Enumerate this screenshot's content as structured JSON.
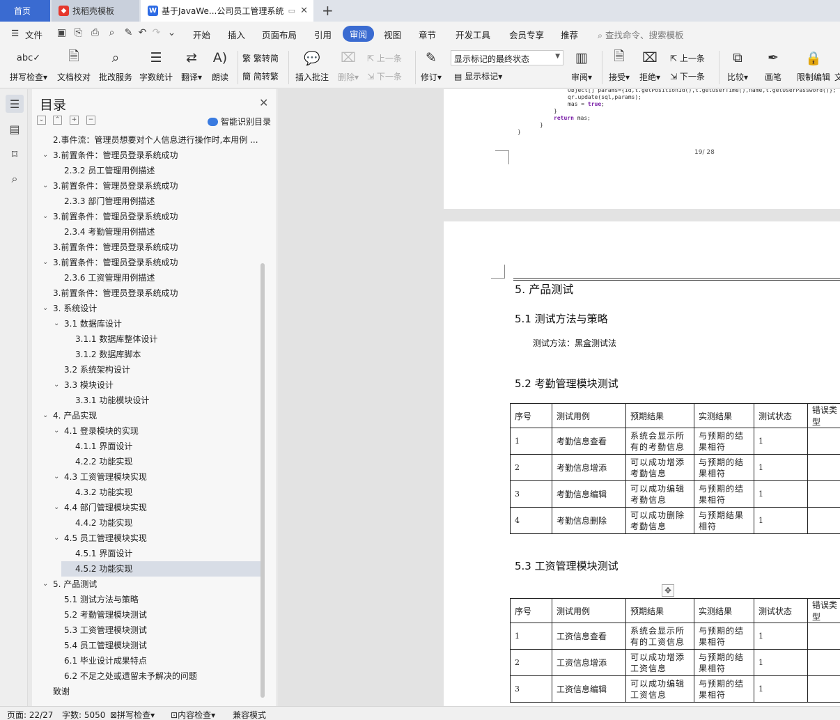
{
  "tabs": {
    "home": "首页",
    "template": "找稻壳模板",
    "document": "基于JavaWe...公司员工管理系统"
  },
  "menu": {
    "file": "文件",
    "items": [
      "开始",
      "插入",
      "页面布局",
      "引用",
      "审阅",
      "视图",
      "章节",
      "开发工具",
      "会员专享",
      "推荐"
    ],
    "search_placeholder": "查找命令、搜索模板"
  },
  "ribbon": {
    "spell_check": "拼写检查",
    "doc_proof": "文档校对",
    "revise_service": "批改服务",
    "word_count": "字数统计",
    "translate": "翻译",
    "read_aloud": "朗读",
    "trad_to_simp": "繁转简",
    "simp_to_trad": "简转繁",
    "insert_comment": "插入批注",
    "delete": "删除",
    "prev_comment": "上一条",
    "next_comment": "下一条",
    "track_changes": "修订",
    "markup_state": "显示标记的最终状态",
    "show_markup": "显示标记",
    "review": "审阅",
    "accept": "接受",
    "reject": "拒绝",
    "prev_change": "上一条",
    "next_change": "下一条",
    "compare": "比较",
    "pen": "画笔",
    "restrict_edit": "限制编辑",
    "cut_off": "文"
  },
  "nav": {
    "title": "目录",
    "smart_toc": "智能识别目录",
    "items": [
      {
        "text": "2.事件流：管理员想要对个人信息进行操作时,本用例 ...",
        "level": 1,
        "chev": false,
        "sel": false
      },
      {
        "text": "3.前置条件：管理员登录系统成功",
        "level": 1,
        "chev": true,
        "sel": false
      },
      {
        "text": "2.3.2 员工管理用例描述",
        "level": 2,
        "chev": false,
        "sel": false
      },
      {
        "text": "3.前置条件：管理员登录系统成功",
        "level": 1,
        "chev": true,
        "sel": false
      },
      {
        "text": "2.3.3 部门管理用例描述",
        "level": 2,
        "chev": false,
        "sel": false
      },
      {
        "text": "3.前置条件：管理员登录系统成功",
        "level": 1,
        "chev": true,
        "sel": false
      },
      {
        "text": "2.3.4 考勤管理用例描述",
        "level": 2,
        "chev": false,
        "sel": false
      },
      {
        "text": "3.前置条件：管理员登录系统成功",
        "level": 1,
        "chev": false,
        "sel": false
      },
      {
        "text": "3.前置条件：管理员登录系统成功",
        "level": 1,
        "chev": true,
        "sel": false
      },
      {
        "text": "2.3.6 工资管理用例描述",
        "level": 2,
        "chev": false,
        "sel": false
      },
      {
        "text": "3.前置条件：管理员登录系统成功",
        "level": 1,
        "chev": false,
        "sel": false
      },
      {
        "text": "3. 系统设计",
        "level": 1,
        "chev": true,
        "sel": false
      },
      {
        "text": "3.1 数据库设计",
        "level": 2,
        "chev": true,
        "sel": false
      },
      {
        "text": "3.1.1 数据库整体设计",
        "level": 3,
        "chev": false,
        "sel": false
      },
      {
        "text": "3.1.2 数据库脚本",
        "level": 3,
        "chev": false,
        "sel": false
      },
      {
        "text": "3.2 系统架构设计",
        "level": 2,
        "chev": false,
        "sel": false
      },
      {
        "text": "3.3 模块设计",
        "level": 2,
        "chev": true,
        "sel": false
      },
      {
        "text": "3.3.1 功能模块设计",
        "level": 3,
        "chev": false,
        "sel": false
      },
      {
        "text": "4. 产品实现",
        "level": 1,
        "chev": true,
        "sel": false
      },
      {
        "text": "4.1 登录模块的实现",
        "level": 2,
        "chev": true,
        "sel": false
      },
      {
        "text": "4.1.1 界面设计",
        "level": 3,
        "chev": false,
        "sel": false
      },
      {
        "text": "4.2.2 功能实现",
        "level": 3,
        "chev": false,
        "sel": false
      },
      {
        "text": "4.3 工资管理模块实现",
        "level": 2,
        "chev": true,
        "sel": false
      },
      {
        "text": "4.3.2 功能实现",
        "level": 3,
        "chev": false,
        "sel": false
      },
      {
        "text": "4.4 部门管理模块实现",
        "level": 2,
        "chev": true,
        "sel": false
      },
      {
        "text": "4.4.2 功能实现",
        "level": 3,
        "chev": false,
        "sel": false
      },
      {
        "text": "4.5 员工管理模块实现",
        "level": 2,
        "chev": true,
        "sel": false
      },
      {
        "text": "4.5.1 界面设计",
        "level": 3,
        "chev": false,
        "sel": false
      },
      {
        "text": "4.5.2 功能实现",
        "level": 3,
        "chev": false,
        "sel": true
      },
      {
        "text": "5. 产品测试",
        "level": 1,
        "chev": true,
        "sel": false
      },
      {
        "text": "5.1 测试方法与策略",
        "level": 2,
        "chev": false,
        "sel": false
      },
      {
        "text": "5.2 考勤管理模块测试",
        "level": 2,
        "chev": false,
        "sel": false
      },
      {
        "text": "5.3 工资管理模块测试",
        "level": 2,
        "chev": false,
        "sel": false
      },
      {
        "text": "5.4 员工管理模块测试",
        "level": 2,
        "chev": false,
        "sel": false
      },
      {
        "text": "6.1 毕业设计成果特点",
        "level": 2,
        "chev": false,
        "sel": false
      },
      {
        "text": "6.2 不足之处或遗留未予解决的问题",
        "level": 2,
        "chev": false,
        "sel": false
      },
      {
        "text": "致谢",
        "level": 1,
        "chev": false,
        "sel": false
      }
    ]
  },
  "doc": {
    "code_lines": [
      "Object[] params={id,t.getPositionId(),t.getUserTime(),name,t.getUserPassword()};",
      "qr.update(sql,params);",
      "mas = true;",
      "}",
      "return mas;",
      "}",
      "}"
    ],
    "code_true": "true",
    "page_number": "19/ 28",
    "heading5": "5.   产品测试",
    "heading51": "5.1 测试方法与策略",
    "method_text": "测试方法：黑盒测试法",
    "heading52": "5.2 考勤管理模块测试",
    "heading53": "5.3 工资管理模块测试",
    "table_headers": [
      "序号",
      "测试用例",
      "预期结果",
      "实测结果",
      "测试状态",
      "错误类型"
    ],
    "attendance_rows": [
      [
        "1",
        "考勤信息查看",
        "系统会显示所有的考勤信息",
        "与预期的结果相符",
        "1"
      ],
      [
        "2",
        "考勤信息增添",
        "可以成功增添考勤信息",
        "与预期的结果相符",
        "1"
      ],
      [
        "3",
        "考勤信息编辑",
        "可以成功编辑考勤信息",
        "与预期的结果相符",
        "1"
      ],
      [
        "4",
        "考勤信息删除",
        "可以成功删除考勤信息",
        "与预期结果相符",
        "1"
      ]
    ],
    "salary_rows": [
      [
        "1",
        "工资信息查看",
        "系统会显示所有的工资信息",
        "与预期的结果相符",
        "1"
      ],
      [
        "2",
        "工资信息增添",
        "可以成功增添工资信息",
        "与预期的结果相符",
        "1"
      ],
      [
        "3",
        "工资信息编辑",
        "可以成功编辑工资信息",
        "与预期的结果相符",
        "1"
      ]
    ]
  },
  "status": {
    "page": "页面: 22/27",
    "words": "字数: 5050",
    "spell": "拼写检查",
    "content_check": "内容检查",
    "compat": "兼容模式"
  }
}
